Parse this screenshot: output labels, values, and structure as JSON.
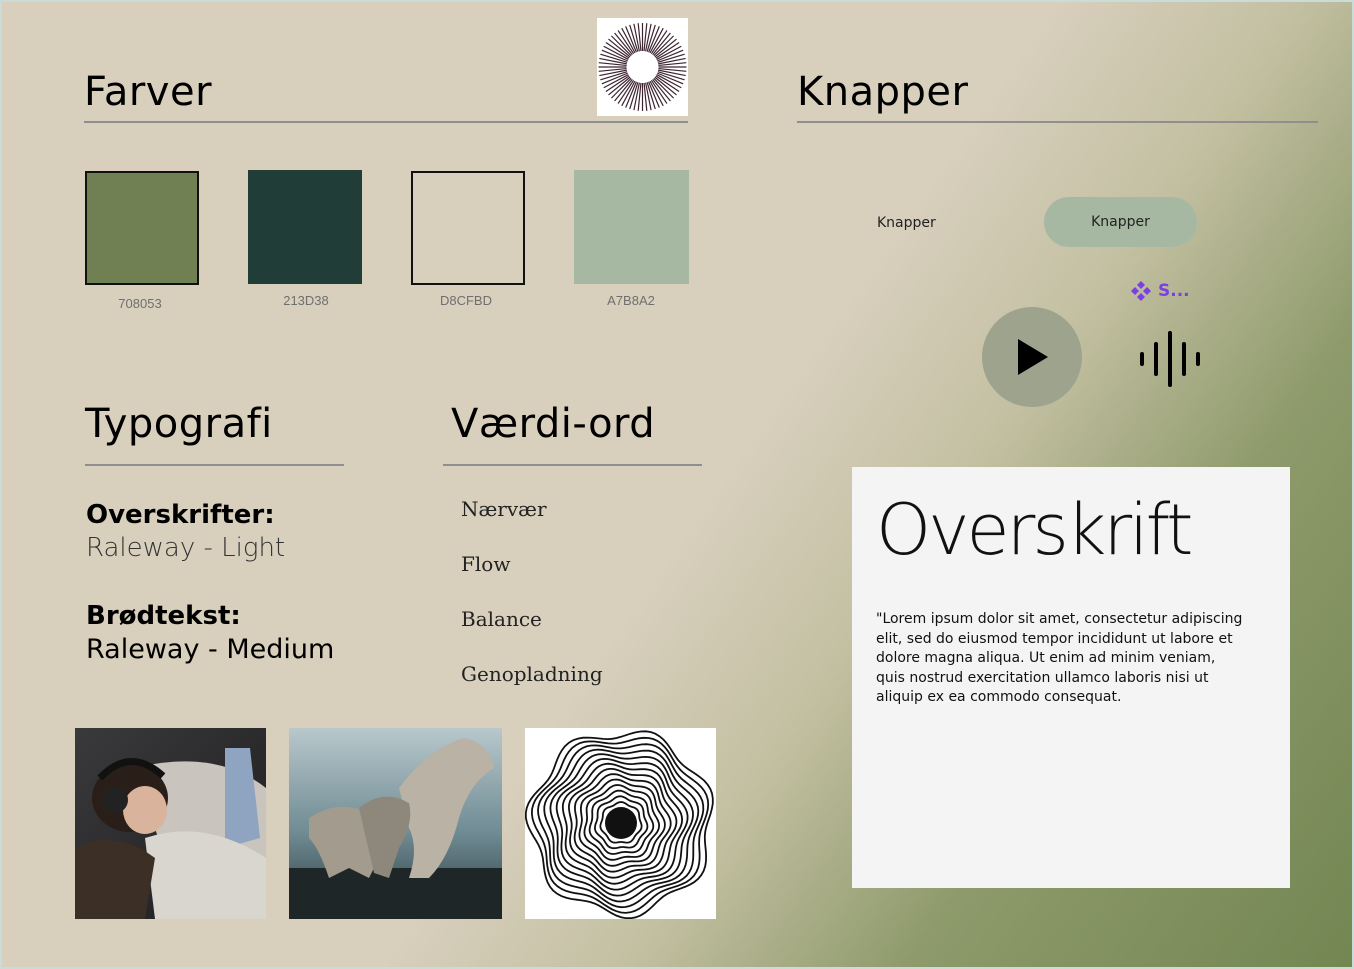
{
  "farver": {
    "title": "Farver",
    "swatches": [
      {
        "hex": "708053",
        "color": "#708053"
      },
      {
        "hex": "213D38",
        "color": "#213D38"
      },
      {
        "hex": "D8CFBD",
        "color": "#D8CFBD"
      },
      {
        "hex": "A7B8A2",
        "color": "#A7B8A2"
      }
    ]
  },
  "knapper": {
    "title": "Knapper",
    "plain_button": "Knapper",
    "pill_button": "Knapper",
    "component_label": "S..."
  },
  "typografi": {
    "title": "Typografi",
    "headings_label": "Overskrifter:",
    "headings_font": "Raleway - Light",
    "body_label": "Brødtekst:",
    "body_font": "Raleway - Medium"
  },
  "vaerdi_ord": {
    "title": "Værdi-ord",
    "words": [
      "Nærvær",
      "Flow",
      "Balance",
      "Genopladning"
    ]
  },
  "sample_card": {
    "heading": "Overskrift",
    "body": "\"Lorem ipsum dolor sit amet, consectetur adipiscing elit, sed do eiusmod tempor incididunt ut labore et dolore magna aliqua. Ut enim ad minim veniam, quis nostrud exercitation ullamco laboris nisi ut aliquip ex ea commodo consequat."
  },
  "colors": {
    "accent_purple": "#7B3FE4",
    "rule": "#8F8F8F"
  }
}
